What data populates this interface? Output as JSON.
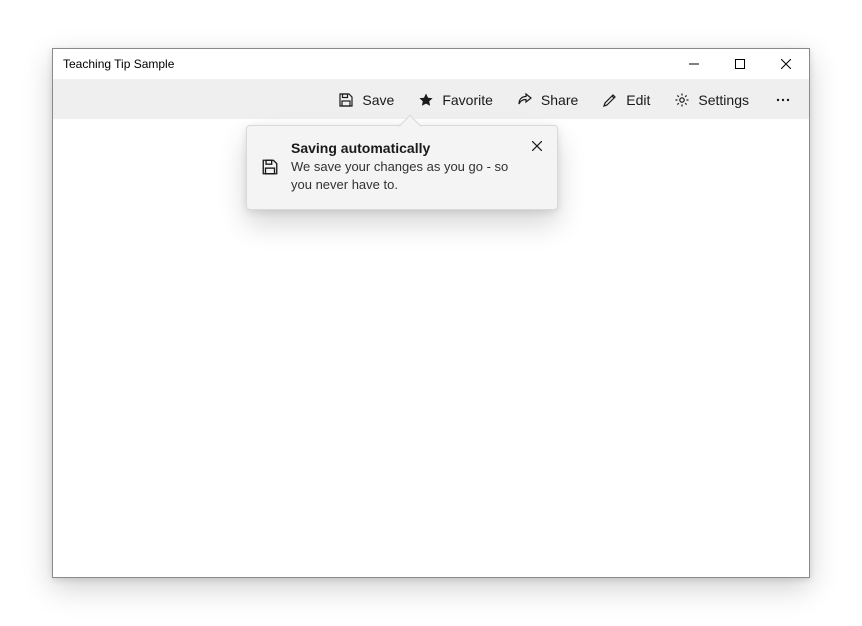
{
  "window": {
    "title": "Teaching Tip Sample"
  },
  "commandbar": {
    "save_label": "Save",
    "favorite_label": "Favorite",
    "share_label": "Share",
    "edit_label": "Edit",
    "settings_label": "Settings"
  },
  "teaching_tip": {
    "title": "Saving automatically",
    "subtitle": "We save your changes as you go - so you never have to."
  }
}
